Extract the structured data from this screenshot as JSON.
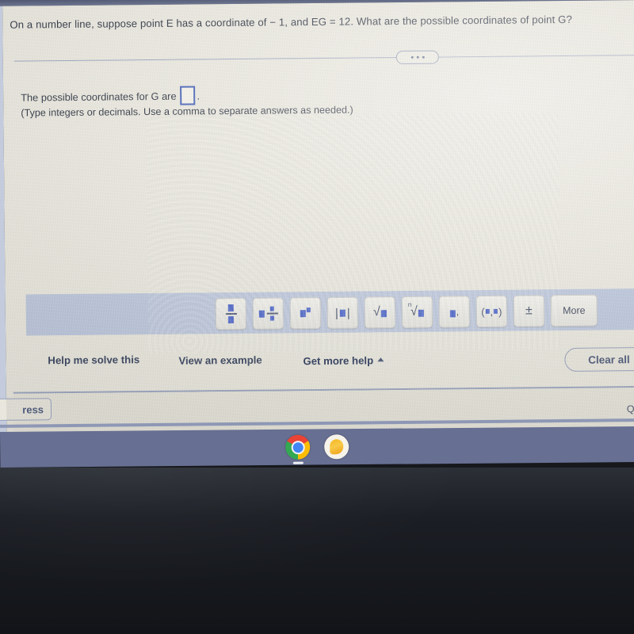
{
  "question": {
    "text": "On a number line, suppose point E has a coordinate of − 1, and EG = 12. What are the possible coordinates of point G?"
  },
  "divider": {
    "ellipsis_label": "•••"
  },
  "answer": {
    "prompt_prefix": "The possible coordinates for G are",
    "prompt_suffix": ".",
    "input_value": "",
    "hint": "(Type integers or decimals. Use a comma to separate answers as needed.)"
  },
  "math_palette": {
    "buttons": [
      {
        "name": "fraction",
        "label": "□/□"
      },
      {
        "name": "mixed-number",
        "label": "□ □/□"
      },
      {
        "name": "exponent",
        "label": "□^□"
      },
      {
        "name": "absolute-value",
        "label": "|□|"
      },
      {
        "name": "square-root",
        "label": "√□"
      },
      {
        "name": "nth-root",
        "label": "ⁿ√□"
      },
      {
        "name": "comma-list",
        "label": "□,"
      },
      {
        "name": "ordered-pair",
        "label": "(□,□)"
      },
      {
        "name": "plus-minus",
        "label": "±"
      },
      {
        "name": "more",
        "label": "More"
      }
    ],
    "abs_bar": "|",
    "root_symbol": "√",
    "root_index": "n",
    "comma": ",",
    "paren_open": "(",
    "paren_close": ")",
    "plus_minus": "±",
    "more_label": "More"
  },
  "help_links": {
    "solve": "Help me solve this",
    "example": "View an example",
    "more_help": "Get more help",
    "clear_all": "Clear all"
  },
  "footer": {
    "progress_button": "ress",
    "question_label": "Questi"
  },
  "shelf": {
    "apps": [
      {
        "name": "chrome",
        "label": "Chrome"
      },
      {
        "name": "app-yellow",
        "label": "App"
      }
    ]
  },
  "colors": {
    "accent_blue": "#4a63c8",
    "link_text": "#3b4660",
    "page_bg": "#e9e7dd",
    "palette_band": "#bdc7dc",
    "shelf": "#676f92"
  }
}
